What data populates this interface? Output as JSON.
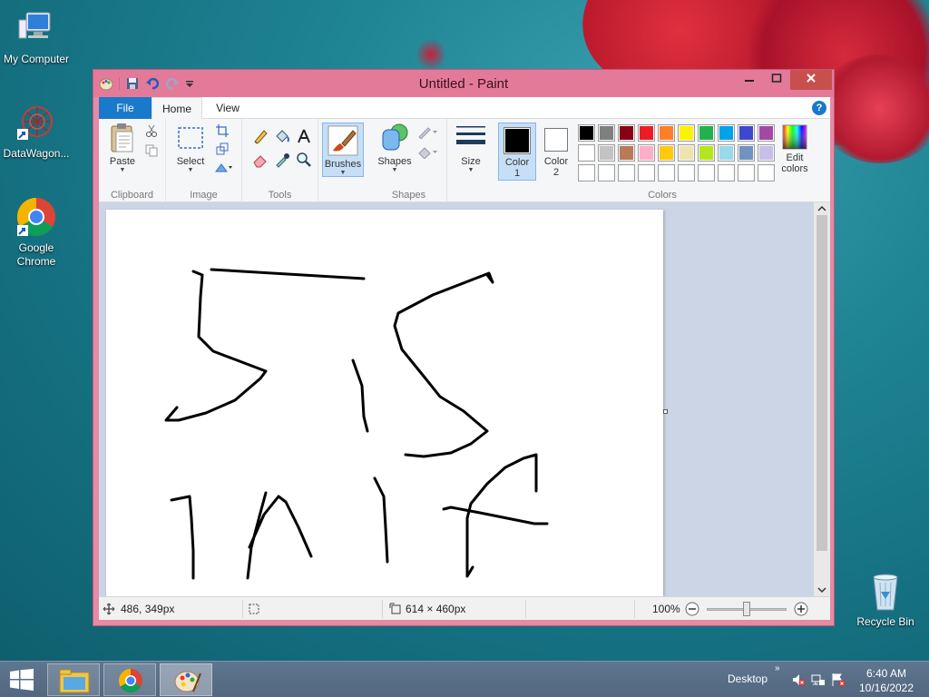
{
  "desktop": {
    "icons": [
      {
        "label": "My Computer"
      },
      {
        "label": "DataWagon..."
      },
      {
        "label": "Google Chrome"
      },
      {
        "label": "Recycle Bin"
      }
    ]
  },
  "window": {
    "title": "Untitled - Paint",
    "tabs": [
      {
        "label": "File"
      },
      {
        "label": "Home"
      },
      {
        "label": "View"
      }
    ],
    "help_label": "?"
  },
  "ribbon": {
    "clipboard": {
      "paste": "Paste",
      "group": "Clipboard"
    },
    "image": {
      "select": "Select",
      "group": "Image"
    },
    "tools": {
      "group": "Tools"
    },
    "brushes": {
      "label": "Brushes"
    },
    "shapes": {
      "label": "Shapes",
      "group": "Shapes"
    },
    "size": {
      "label": "Size"
    },
    "color1": {
      "line1": "Color",
      "line2": "1",
      "value": "#000000"
    },
    "color2": {
      "line1": "Color",
      "line2": "2",
      "value": "#ffffff"
    },
    "colors_group": "Colors",
    "edit_colors": {
      "line1": "Edit",
      "line2": "colors"
    },
    "palette_row1": [
      "#000000",
      "#7f7f7f",
      "#880015",
      "#ed1c24",
      "#ff7f27",
      "#fff200",
      "#22b14c",
      "#00a2e8",
      "#3f48cc",
      "#a349a4"
    ],
    "palette_row2": [
      "#ffffff",
      "#c3c3c3",
      "#b97a57",
      "#ffaec9",
      "#ffc90e",
      "#efe4b0",
      "#b5e61d",
      "#99d9ea",
      "#7092be",
      "#c8bfe7"
    ],
    "palette_row3": [
      "#ffffff",
      "#ffffff",
      "#ffffff",
      "#ffffff",
      "#ffffff",
      "#ffffff",
      "#ffffff",
      "#ffffff",
      "#ffffff",
      "#ffffff"
    ]
  },
  "status": {
    "cursor_pos": "486, 349px",
    "canvas_size": "614 × 460px",
    "zoom": "100%"
  },
  "taskbar": {
    "desktop_label": "Desktop",
    "time": "6:40 AM",
    "date": "10/16/2022"
  }
}
